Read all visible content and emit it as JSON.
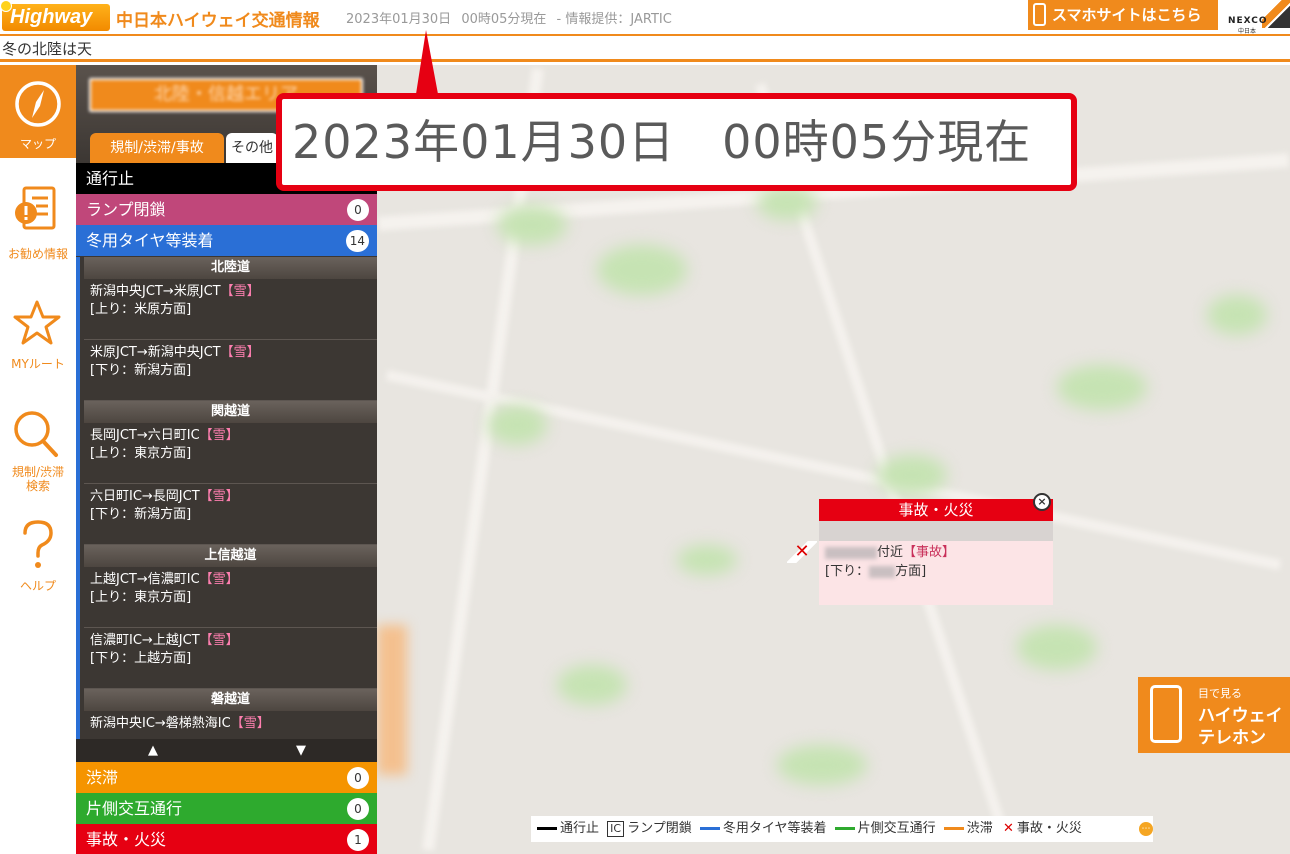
{
  "header": {
    "logo_text": "Highway",
    "site_title": "中日本ハイウェイ交通情報",
    "date": "2023年01月30日",
    "time": "00時05分現在",
    "source": "- 情報提供：JARTIC",
    "sp_button": "スマホサイトはこちら",
    "nexco_text": "NEXCO",
    "nexco_sub": "中日本"
  },
  "ticker": "冬の北陸は天",
  "nav": {
    "items": [
      {
        "label": "マップ",
        "icon": "compass-icon"
      },
      {
        "label": "お勧め情報",
        "icon": "document-alert-icon"
      },
      {
        "label": "MYルート",
        "icon": "star-icon"
      },
      {
        "label": "規制/渋滞",
        "label2": "検索",
        "icon": "search-icon"
      },
      {
        "label": "ヘルプ",
        "icon": "question-icon"
      }
    ]
  },
  "panel": {
    "area_button": "北陸・信越エリア",
    "tabs": [
      "規制/渋滞/事故",
      "その他"
    ],
    "categories": {
      "closure": {
        "label": "通行止",
        "count": ""
      },
      "ramp": {
        "label": "ランプ閉鎖",
        "count": "0"
      },
      "winter": {
        "label": "冬用タイヤ等装着",
        "count": "14"
      },
      "jam": {
        "label": "渋滞",
        "count": "0"
      },
      "oneside": {
        "label": "片側交互通行",
        "count": "0"
      },
      "accident": {
        "label": "事故・火災",
        "count": "1"
      }
    },
    "roads": [
      {
        "name": "北陸道",
        "entries": [
          {
            "route": "新潟中央JCT→米原JCT",
            "tag": "【雪】",
            "dir": "[上り：米原方面]"
          },
          {
            "route": "米原JCT→新潟中央JCT",
            "tag": "【雪】",
            "dir": "[下り：新潟方面]"
          }
        ]
      },
      {
        "name": "関越道",
        "entries": [
          {
            "route": "長岡JCT→六日町IC",
            "tag": "【雪】",
            "dir": "[上り：東京方面]"
          },
          {
            "route": "六日町IC→長岡JCT",
            "tag": "【雪】",
            "dir": "[下り：新潟方面]"
          }
        ]
      },
      {
        "name": "上信越道",
        "entries": [
          {
            "route": "上越JCT→信濃町IC",
            "tag": "【雪】",
            "dir": "[上り：東京方面]"
          },
          {
            "route": "信濃町IC→上越JCT",
            "tag": "【雪】",
            "dir": "[下り：上越方面]"
          }
        ]
      },
      {
        "name": "磐越道",
        "entries": [
          {
            "route": "新潟中央IC→磐梯熱海IC",
            "tag": "【雪】",
            "dir": ""
          }
        ]
      }
    ],
    "scroll_up": "▲",
    "scroll_down": "▼"
  },
  "popup": {
    "title": "事故・火災",
    "close": "×",
    "near": "付近",
    "tag": "【事故】",
    "dir_prefix": "[下り：",
    "dir_suffix": "方面]"
  },
  "legend": {
    "closure": "通行止",
    "ic": "IC",
    "ramp": "ランプ閉鎖",
    "winter": "冬用タイヤ等装着",
    "oneside": "片側交互通行",
    "jam": "渋滞",
    "accident": "事故・火災",
    "colors": {
      "closure": "#000000",
      "winter": "#2a6fd6",
      "oneside": "#2eaa2e",
      "jam": "#f08a1c",
      "accident": "#e60012"
    }
  },
  "tel_banner": {
    "line1": "目で見る",
    "line2": "ハイウェイ",
    "line3": "テレホン"
  },
  "callout": {
    "text": "2023年01月30日　00時05分現在"
  },
  "colors": {
    "accent": "#f08a1c",
    "panel_bg": "#3c3733",
    "ramp": "#c0477a",
    "winter": "#2a6fd6",
    "jam": "#f59400",
    "oneside": "#2eaa2e",
    "accident": "#e60012",
    "callout_border": "#e60012"
  }
}
